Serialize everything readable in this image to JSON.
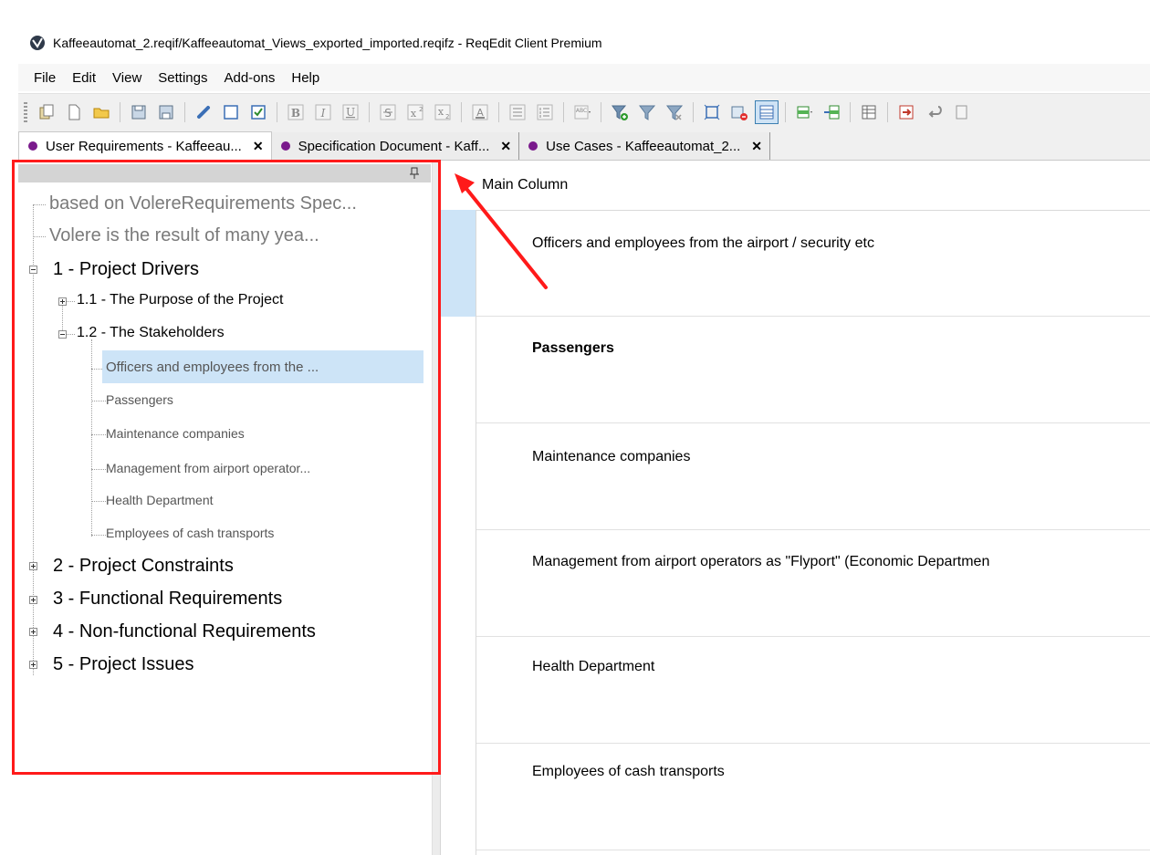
{
  "window": {
    "title": "Kaffeeautomat_2.reqif/Kaffeeautomat_Views_exported_imported.reqifz - ReqEdit Client Premium"
  },
  "menu": [
    "File",
    "Edit",
    "View",
    "Settings",
    "Add-ons",
    "Help"
  ],
  "toolbar": {
    "buttons": [
      "copy-icon",
      "new-document-icon",
      "open-folder-icon",
      "save-icon",
      "save-as-icon",
      "link-icon",
      "checkbox-empty-icon",
      "checkbox-checked-icon",
      "bold-icon",
      "italic-icon",
      "underline-icon",
      "strikethrough-icon",
      "superscript-icon",
      "subscript-icon",
      "font-color-icon",
      "bullet-list-icon",
      "numbered-list-icon",
      "spellcheck-icon",
      "filter-add-icon",
      "filter-icon",
      "filter-remove-icon",
      "fit-window-icon",
      "remove-object-icon",
      "table-view-icon",
      "insert-row-icon",
      "insert-child-icon",
      "table-settings-icon",
      "export-icon",
      "wrap-icon",
      "document-icon"
    ]
  },
  "tabs": [
    {
      "label": "User Requirements - Kaffeeau...",
      "active": true
    },
    {
      "label": "Specification Document - Kaff...",
      "active": false
    },
    {
      "label": "Use Cases - Kaffeeautomat_2...",
      "active": false
    }
  ],
  "tree": {
    "items": [
      {
        "label": "based on VolereRequirements Spec..."
      },
      {
        "label": "Volere is the result of many yea..."
      },
      {
        "label": "1 - Project Drivers"
      },
      {
        "label": "1.1 - The Purpose of the Project"
      },
      {
        "label": "1.2 - The Stakeholders"
      },
      {
        "label": "Officers and employees from the ..."
      },
      {
        "label": "Passengers"
      },
      {
        "label": "Maintenance companies"
      },
      {
        "label": "Management from airport operator..."
      },
      {
        "label": "Health Department"
      },
      {
        "label": "Employees of cash transports"
      },
      {
        "label": "2 - Project Constraints"
      },
      {
        "label": "3 - Functional Requirements"
      },
      {
        "label": "4 - Non-functional Requirements"
      },
      {
        "label": "5 - Project Issues"
      }
    ]
  },
  "main": {
    "column_header": "Main Column",
    "rows": [
      {
        "text": "Officers and employees from the airport / security etc"
      },
      {
        "text": "Passengers"
      },
      {
        "text": "Maintenance companies"
      },
      {
        "text": "Management from airport operators as \"Flyport\" (Economic Departmen"
      },
      {
        "text": "Health Department"
      },
      {
        "text": "Employees of cash transports"
      }
    ]
  },
  "colors": {
    "highlight": "#ff1a1a",
    "selection": "#cde4f7",
    "tab_dot": "#7a1a8c"
  }
}
